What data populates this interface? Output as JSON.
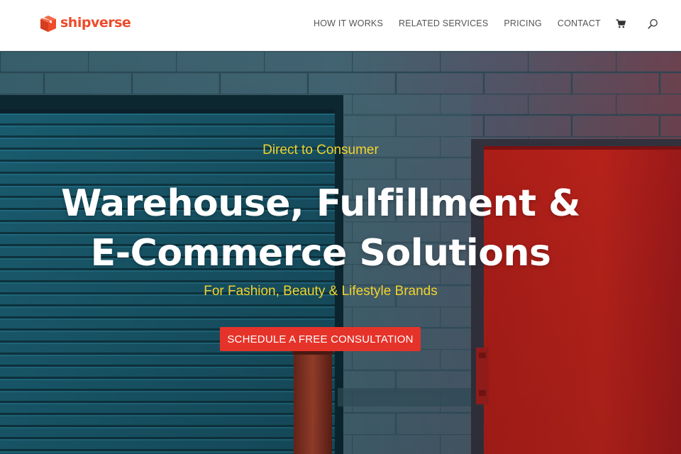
{
  "brand": {
    "name": "shipverse",
    "logo_icon": "box-icon",
    "color": "#ee4b2b"
  },
  "nav": {
    "items": [
      {
        "label": "HOW IT WORKS"
      },
      {
        "label": "RELATED SERVICES"
      },
      {
        "label": "PRICING"
      },
      {
        "label": "CONTACT"
      }
    ],
    "cart_icon": "cart-icon",
    "search_icon": "search-icon"
  },
  "hero": {
    "eyebrow": "Direct to Consumer",
    "headline_line1": "Warehouse, Fulfillment &",
    "headline_line2": "E-Commerce Solutions",
    "subline": "For Fashion, Beauty & Lifestyle Brands",
    "cta_label": "SCHEDULE A FREE CONSULTATION",
    "accent_color": "#f2d32b",
    "cta_color": "#e6332a"
  }
}
